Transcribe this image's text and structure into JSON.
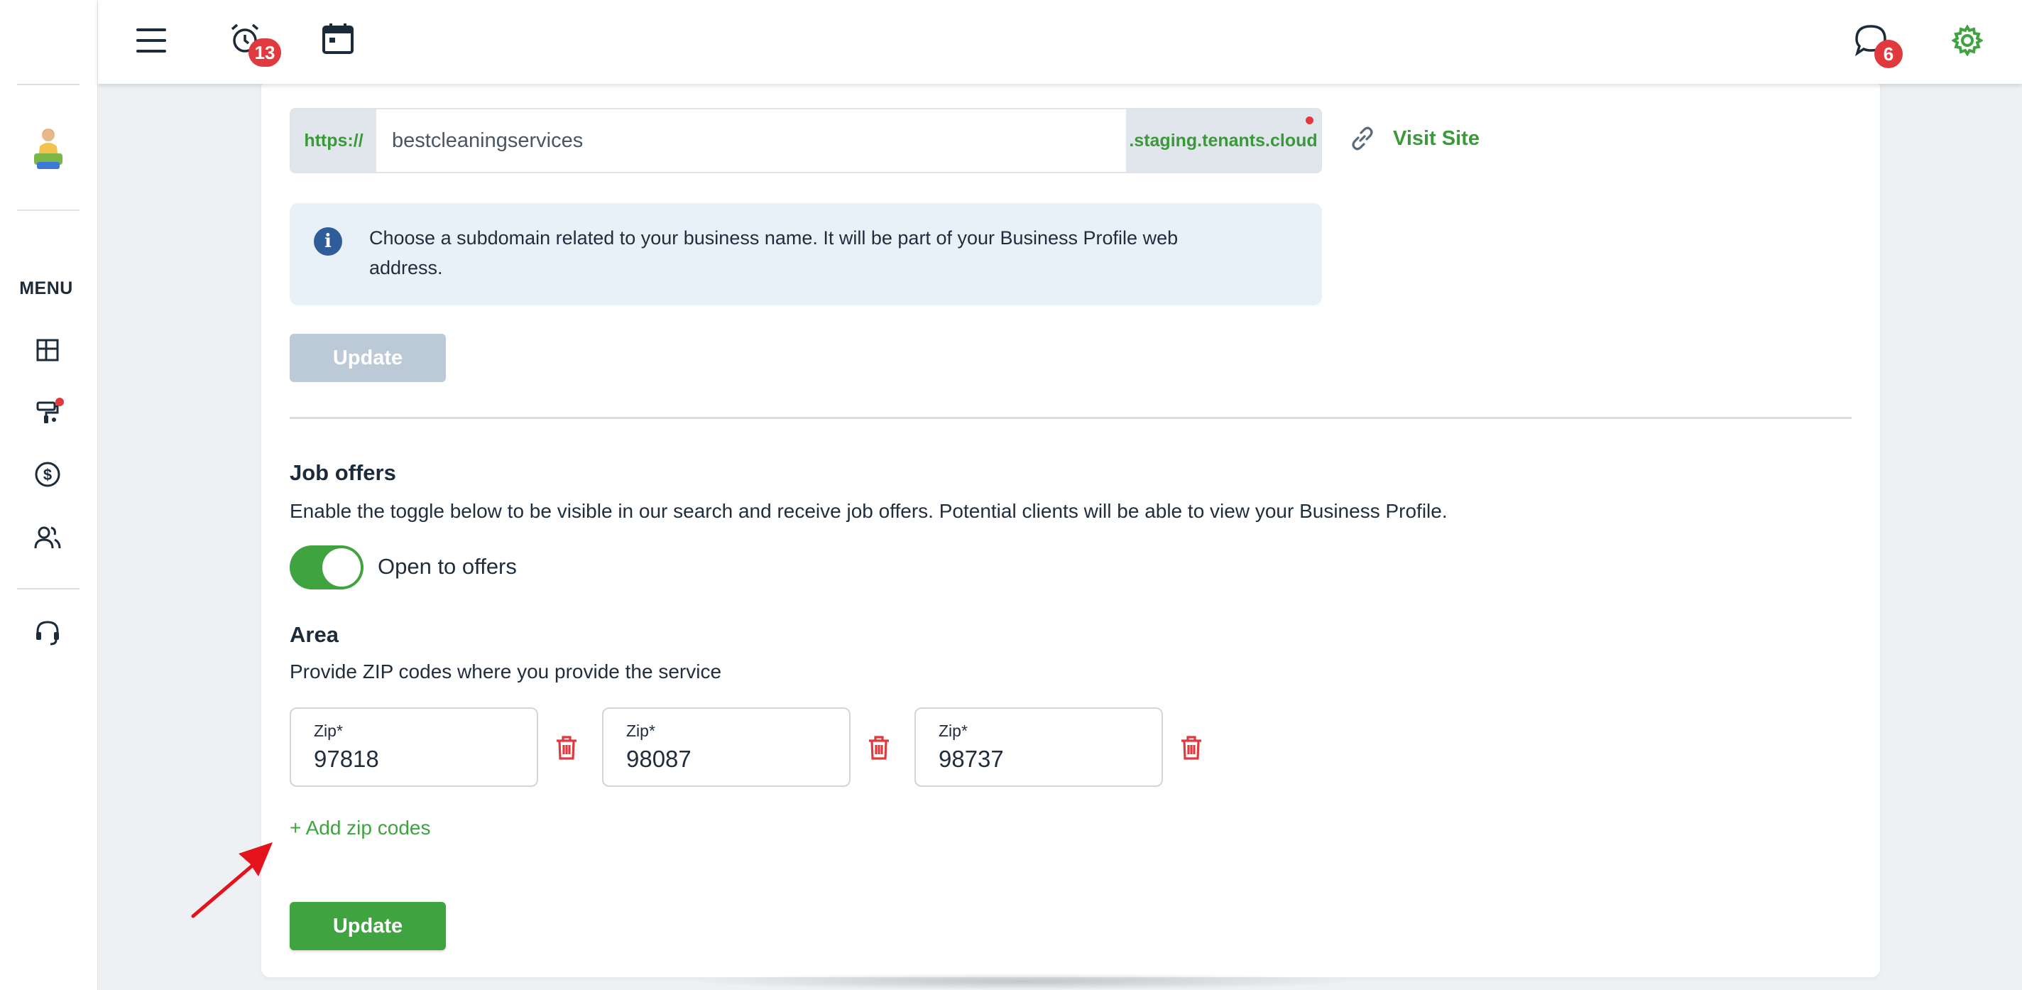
{
  "sidebar": {
    "menu_label": "MENU",
    "items": [
      {
        "icon": "dashboard-icon"
      },
      {
        "icon": "paint-roller-icon",
        "has_notification": true
      },
      {
        "icon": "dollar-icon"
      },
      {
        "icon": "users-icon"
      },
      {
        "icon": "headset-icon"
      }
    ]
  },
  "topbar": {
    "alarm_badge": "13",
    "chat_badge": "6",
    "icons": [
      "hamburger-icon",
      "alarm-icon",
      "calendar-icon",
      "chat-icon",
      "gear-icon"
    ]
  },
  "subdomain": {
    "prefix": "https://",
    "value": "bestcleaningservices",
    "suffix": ".staging.tenants.cloud",
    "visit_label": "Visit Site",
    "info": "Choose a subdomain related to your business name. It will be part of your Business Profile web address.",
    "update_label": "Update"
  },
  "job_offers": {
    "title": "Job offers",
    "description": "Enable the toggle below to be visible in our search and receive job offers. Potential clients will be able to view your Business Profile.",
    "toggle_label": "Open to offers",
    "toggle_on": true
  },
  "area": {
    "title": "Area",
    "description": "Provide ZIP codes where you provide the service",
    "zip_label": "Zip*",
    "zips": [
      "97818",
      "98087",
      "98737"
    ],
    "add_label": "+ Add zip codes",
    "update_label": "Update"
  },
  "colors": {
    "accent_green": "#3fa43f",
    "danger_red": "#e0393e",
    "info_bg": "#e8f0f8",
    "disabled_button": "#bcc9d6"
  }
}
